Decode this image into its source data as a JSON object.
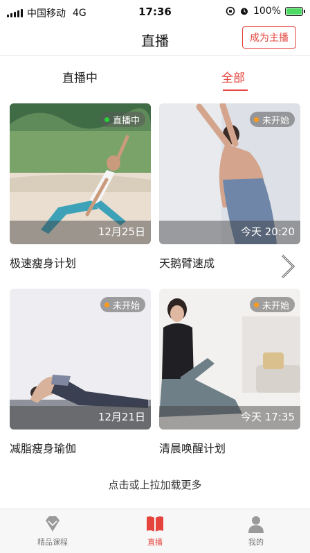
{
  "status_bar": {
    "carrier": "中国移动",
    "network": "4G",
    "time": "17:36",
    "battery": "100%"
  },
  "nav": {
    "title": "直播",
    "anchor_button": "成为主播"
  },
  "tabs": {
    "live": "直播中",
    "all": "全部",
    "active": "all"
  },
  "cards": [
    {
      "title": "极速瘦身计划",
      "badge": "直播中",
      "time": "12月25日",
      "status": "live"
    },
    {
      "title": "天鹅臂速成",
      "badge": "未开始",
      "time": "今天 20:20",
      "status": "upcoming"
    },
    {
      "title": "减脂瘦身瑜伽",
      "badge": "未开始",
      "time": "12月21日",
      "status": "upcoming"
    },
    {
      "title": "清晨唤醒计划",
      "badge": "未开始",
      "time": "今天 17:35",
      "status": "upcoming"
    }
  ],
  "load_more": "点击或上拉加载更多",
  "tab_bar": {
    "items": [
      {
        "label": "精品课程",
        "icon": "diamond-icon"
      },
      {
        "label": "直播",
        "icon": "book-icon"
      },
      {
        "label": "我的",
        "icon": "person-icon"
      }
    ],
    "active_index": 1
  },
  "colors": {
    "accent": "#e5443c",
    "live_dot": "#28d13b",
    "upcoming_dot": "#ff9a1a"
  }
}
